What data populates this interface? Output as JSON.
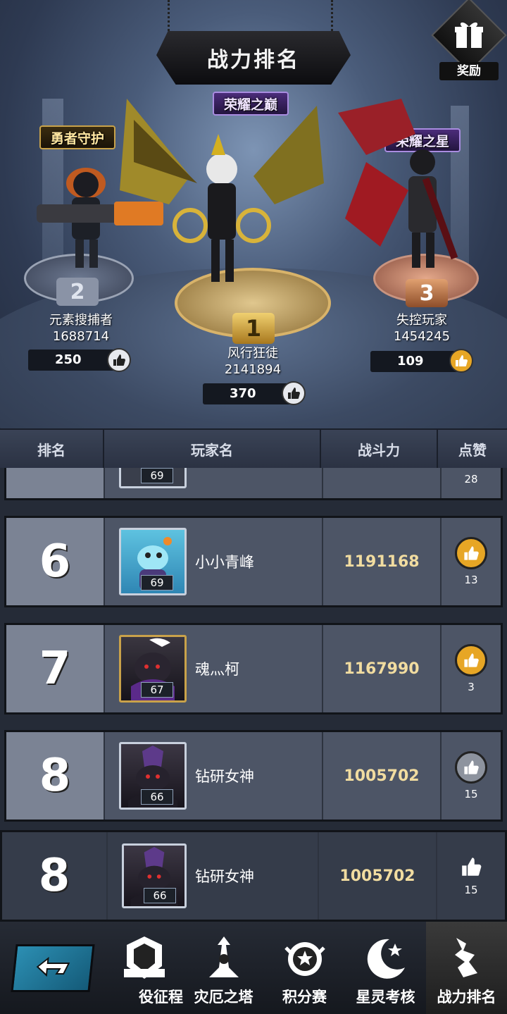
{
  "header": {
    "title": "战力排名",
    "reward_label": "奖励"
  },
  "podium": {
    "tags": {
      "first": "荣耀之巅",
      "second": "勇者守护",
      "third": "荣耀之星"
    },
    "first": {
      "rank": "1",
      "name": "风行狂徒",
      "power": "2141894",
      "likes": "370"
    },
    "second": {
      "rank": "2",
      "name": "元素搜捕者",
      "power": "1688714",
      "likes": "250"
    },
    "third": {
      "rank": "3",
      "name": "失控玩家",
      "power": "1454245",
      "likes": "109"
    }
  },
  "table": {
    "headers": [
      "排名",
      "玩家名",
      "战斗力",
      "点赞"
    ],
    "partial_row": {
      "level": "69",
      "likes": "28"
    },
    "rows": [
      {
        "rank": "6",
        "name": "小小青峰",
        "level": "69",
        "power": "1191168",
        "likes": "13"
      },
      {
        "rank": "7",
        "name": "魂灬柯",
        "level": "67",
        "power": "1167990",
        "likes": "3"
      },
      {
        "rank": "8",
        "name": "钻研女神",
        "level": "66",
        "power": "1005702",
        "likes": "15"
      }
    ],
    "self_row": {
      "rank": "8",
      "name": "钻研女神",
      "level": "66",
      "power": "1005702",
      "likes": "15"
    }
  },
  "nav": {
    "items": [
      "战役征程",
      "灾厄之塔",
      "积分赛",
      "星灵考核",
      "战力排名"
    ],
    "first_item_visible": "役征程"
  },
  "colors": {
    "gold_accent": "#f1dca0",
    "like_gold": "#e7a625",
    "like_gray": "#8d939e"
  }
}
